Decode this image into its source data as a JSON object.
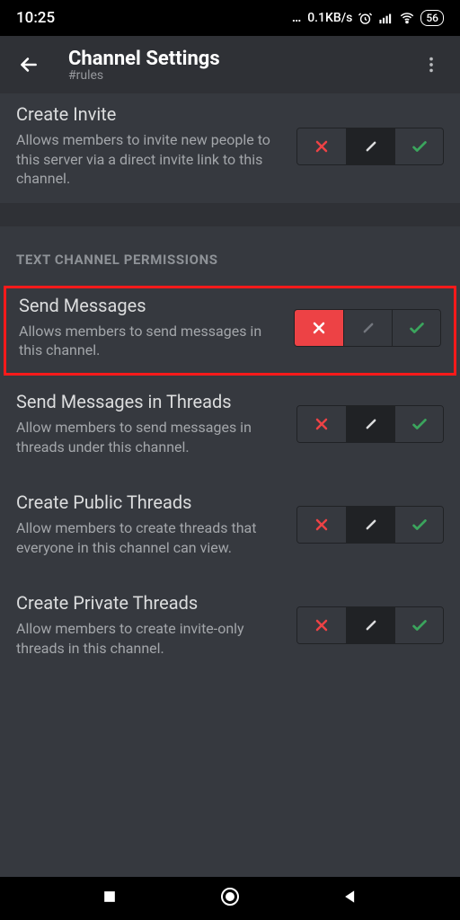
{
  "status": {
    "time": "10:25",
    "speed": "0.1KB/s",
    "battery": "56"
  },
  "header": {
    "title": "Channel Settings",
    "subtitle": "#rules"
  },
  "section_inherited_last": {
    "title": "Create Invite",
    "desc": "Allows members to invite new people to this server via a direct invite link to this channel."
  },
  "section_label": "TEXT CHANNEL PERMISSIONS",
  "perms": {
    "send": {
      "title": "Send Messages",
      "desc": "Allows members to send messages in this channel."
    },
    "send_threads": {
      "title": "Send Messages in Threads",
      "desc": "Allow members to send messages in threads under this channel."
    },
    "create_public": {
      "title": "Create Public Threads",
      "desc": "Allow members to create threads that everyone in this channel can view."
    },
    "create_private": {
      "title": "Create Private Threads",
      "desc": "Allow members to create invite-only threads in this channel."
    }
  }
}
